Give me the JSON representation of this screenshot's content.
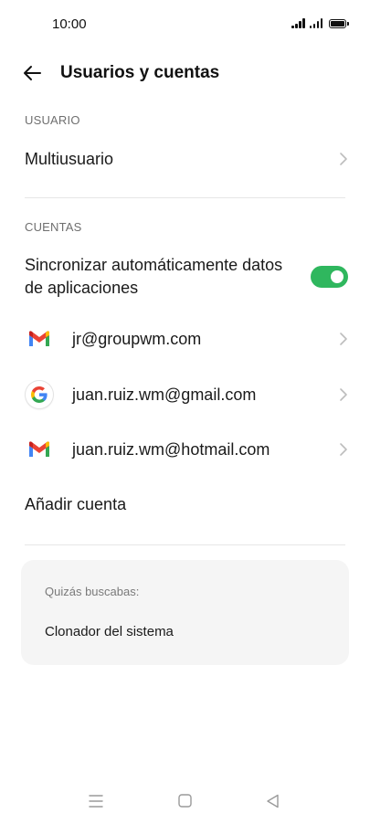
{
  "status_bar": {
    "time": "10:00"
  },
  "header": {
    "title": "Usuarios y cuentas",
    "back_icon": "back-arrow-icon"
  },
  "sections": {
    "usuario": {
      "header": "USUARIO",
      "multiuser_label": "Multiusuario"
    },
    "cuentas": {
      "header": "CUENTAS",
      "sync": {
        "label": "Sincronizar automáticamente datos de aplicaciones",
        "enabled": true
      },
      "accounts": [
        {
          "label": "jr@groupwm.com",
          "icon": "gmail-icon"
        },
        {
          "label": "juan.ruiz.wm@gmail.com",
          "icon": "google-icon"
        },
        {
          "label": "juan.ruiz.wm@hotmail.com",
          "icon": "gmail-icon"
        }
      ],
      "add_account_label": "Añadir cuenta"
    }
  },
  "suggestions": {
    "title": "Quizás buscabas:",
    "items": [
      "Clonador del sistema"
    ]
  },
  "colors": {
    "toggle_on": "#2fb75e",
    "card_bg": "#f5f5f5"
  },
  "nav_bar": {
    "icons": [
      "menu-icon",
      "home-icon",
      "back-icon"
    ]
  }
}
